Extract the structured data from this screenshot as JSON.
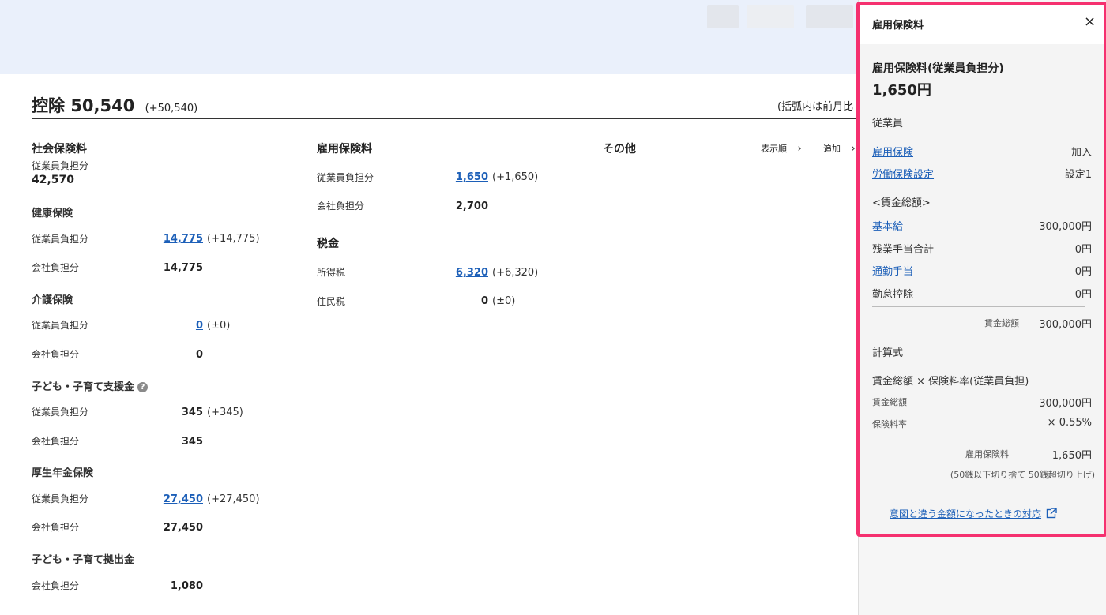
{
  "deductions": {
    "title": "控除",
    "total": "50,540",
    "total_delta": "(+50,540)",
    "note": "(括弧内は前月比"
  },
  "social_insurance": {
    "heading": "社会保険料",
    "employee_label": "従業員負担分",
    "employee_total": "42,570",
    "groups": [
      {
        "name": "健康保険",
        "rows": [
          {
            "label": "従業員負担分",
            "value": "14,775",
            "delta": "(+14,775)"
          },
          {
            "label": "会社負担分",
            "value": "14,775",
            "delta": ""
          }
        ]
      },
      {
        "name": "介護保険",
        "rows": [
          {
            "label": "従業員負担分",
            "value": "0",
            "delta": "(±0)"
          },
          {
            "label": "会社負担分",
            "value": "0",
            "delta": ""
          }
        ]
      },
      {
        "name": "子ども・子育て支援金",
        "rows": [
          {
            "label": "従業員負担分",
            "value": "345",
            "delta": "(+345)"
          },
          {
            "label": "会社負担分",
            "value": "345",
            "delta": ""
          }
        ]
      },
      {
        "name": "厚生年金保険",
        "rows": [
          {
            "label": "従業員負担分",
            "value": "27,450",
            "delta": "(+27,450)"
          },
          {
            "label": "会社負担分",
            "value": "27,450",
            "delta": ""
          }
        ]
      },
      {
        "name": "子ども・子育て拠出金",
        "rows": [
          {
            "label": "会社負担分",
            "value": "1,080",
            "delta": ""
          }
        ]
      }
    ]
  },
  "employment_insurance": {
    "heading": "雇用保険料",
    "rows": [
      {
        "label": "従業員負担分",
        "value": "1,650",
        "delta": "(+1,650)"
      },
      {
        "label": "会社負担分",
        "value": "2,700",
        "delta": ""
      }
    ]
  },
  "taxes": {
    "heading": "税金",
    "rows": [
      {
        "label": "所得税",
        "value": "6,320",
        "delta": "(+6,320)"
      },
      {
        "label": "住民税",
        "value": "0",
        "delta": "(±0)"
      }
    ]
  },
  "other": {
    "heading": "その他",
    "sort_label": "表示順",
    "add_label": "追加"
  },
  "panel": {
    "title": "雇用保険料",
    "close": "×",
    "subtitle": "雇用保険料(従業員負担分)",
    "amount": "1,650円",
    "employee_section": "従業員",
    "emp_rows": [
      {
        "label": "雇用保険",
        "value": "加入"
      },
      {
        "label": "労働保険設定",
        "value": "設定1"
      }
    ],
    "wage_heading": "<賃金総額>",
    "wage_rows": [
      {
        "label": "基本給",
        "value": "300,000円",
        "link": true
      },
      {
        "label": "残業手当合計",
        "value": "0円",
        "link": false
      },
      {
        "label": "通勤手当",
        "value": "0円",
        "link": true
      },
      {
        "label": "勤怠控除",
        "value": "0円",
        "link": false
      }
    ],
    "wage_total_label": "賃金総額",
    "wage_total_value": "300,000円",
    "formula_heading": "計算式",
    "formula_text": "賃金総額 × 保険料率(従業員負担)",
    "formula_rows": [
      {
        "label": "賃金総額",
        "value": "300,000円"
      },
      {
        "label": "保険料率",
        "value": "× 0.55%"
      }
    ],
    "result_label": "雇用保険料",
    "result_value": "1,650円",
    "rounding_note": "(50銭以下切り捨て 50銭超切り上げ)",
    "help_link": "意図と違う金額になったときの対応"
  }
}
